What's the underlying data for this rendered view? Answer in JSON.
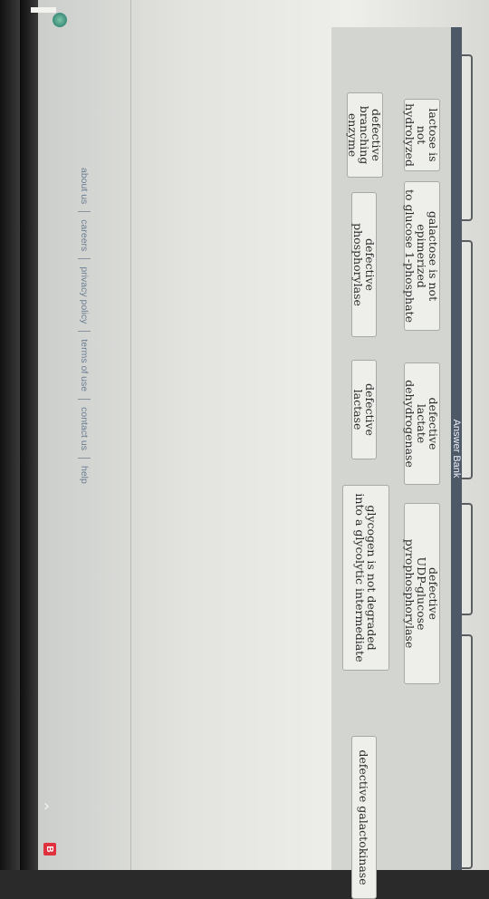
{
  "answer_bank": {
    "title": "Answer Bank",
    "items": [
      {
        "lines": [
          "lactose is",
          "not hydrolyzed"
        ]
      },
      {
        "lines": [
          "galactose is not epimerized",
          "to glucose 1-phosphate"
        ]
      },
      {
        "lines": [
          "defective",
          "lactate dehydrogenase"
        ]
      },
      {
        "lines": [
          "defective",
          "UDP-glucose pyrophosphorylase"
        ]
      },
      {
        "lines": [
          "defective",
          "branching enzyme"
        ]
      },
      {
        "lines": [
          "defective phosphorylase"
        ]
      },
      {
        "lines": [
          "defective lactase"
        ]
      },
      {
        "lines": [
          "glycogen is not degraded",
          "into a glycolytic intermediate"
        ]
      },
      {
        "lines": [
          "defective galactokinase"
        ]
      }
    ]
  },
  "footer": {
    "links": [
      "about us",
      "careers",
      "privacy policy",
      "terms of use",
      "contact us",
      "help"
    ]
  },
  "browser": {
    "badge_letter": "B",
    "chevron": "›"
  },
  "colors": {
    "header_bg": "#4d5966",
    "bank_bg": "#d3d5d1",
    "badge_red": "#e0313f"
  }
}
